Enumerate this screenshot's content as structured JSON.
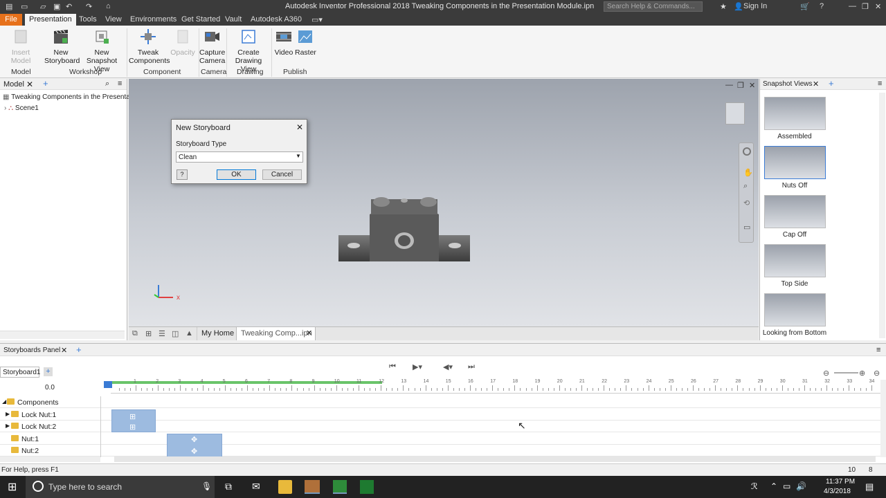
{
  "window": {
    "title": "Autodesk Inventor Professional 2018    Tweaking Components in the Presentation Module.ipn",
    "search_placeholder": "Search Help & Commands...",
    "sign_in": "Sign In"
  },
  "menu": {
    "tabs": [
      "File",
      "Presentation",
      "Tools",
      "View",
      "Environments",
      "Get Started",
      "Vault",
      "Autodesk A360"
    ]
  },
  "ribbon": {
    "buttons": {
      "insert_model": "Insert Model",
      "new_storyboard": "New Storyboard",
      "new_snapshot_view": "New Snapshot View",
      "tweak_components": "Tweak Components",
      "opacity": "Opacity",
      "capture_camera": "Capture Camera",
      "create_drawing_view": "Create Drawing View",
      "video": "Video",
      "raster": "Raster"
    },
    "groups": {
      "model": "Model",
      "workshop": "Workshop",
      "component": "Component",
      "camera": "Camera",
      "drawing": "Drawing",
      "publish": "Publish"
    }
  },
  "browser": {
    "tab": "Model",
    "root": "Tweaking Components in the Presentation M",
    "scene": "Scene1"
  },
  "viewport": {
    "axis_x": "x"
  },
  "doc_tabs": {
    "home": "My Home",
    "active": "Tweaking Comp...ipn"
  },
  "snapshot_views": {
    "title": "Snapshot Views",
    "items": [
      "Assembled",
      "Nuts Off",
      "Cap Off",
      "Top Side",
      "Looking from Bottom"
    ]
  },
  "dialog": {
    "title": "New Storyboard",
    "label": "Storyboard Type",
    "value": "Clean",
    "ok": "OK",
    "cancel": "Cancel"
  },
  "storyboards": {
    "panel_title": "Storyboards Panel",
    "tab": "Storyboard1",
    "current_time": "0.0",
    "ticks": [
      "1",
      "2",
      "3",
      "4",
      "5",
      "6",
      "7",
      "8",
      "9",
      "10",
      "11",
      "12",
      "13",
      "14",
      "15",
      "16",
      "17",
      "18",
      "19",
      "20",
      "21",
      "22",
      "23",
      "24",
      "25",
      "26",
      "27",
      "28",
      "29",
      "30",
      "31",
      "32",
      "33",
      "34"
    ],
    "rows": [
      "Components",
      "Lock Nut:1",
      "Lock Nut:2",
      "Nut:1",
      "Nut:2"
    ]
  },
  "status": {
    "help": "For Help, press F1",
    "count1": "10",
    "count2": "8"
  },
  "taskbar": {
    "search": "Type here to search",
    "time": "11:37 PM",
    "date": "4/3/2018"
  },
  "colors": {
    "titlebar": "#3b3b3b",
    "file_tab": "#e7711b",
    "clip": "#9dbbe0",
    "timeline_green": "#6ac46a"
  }
}
